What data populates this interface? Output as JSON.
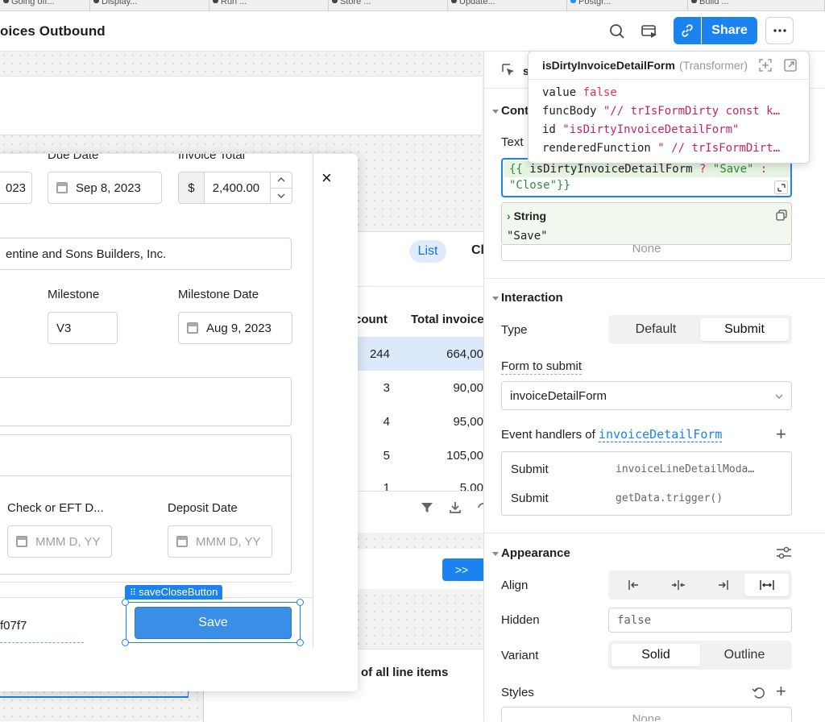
{
  "tabs": [
    "Going off...",
    "Display...",
    "Run ...",
    "Store ...",
    "Update...",
    "Postgr...",
    "Build ..."
  ],
  "header": {
    "title": "oices Outbound",
    "share_label": "Share"
  },
  "background": {
    "list_tab": "List",
    "second_tab": "Cl",
    "table": {
      "headers": [
        "count",
        "Total invoice"
      ],
      "rows": [
        [
          "244",
          "664,00"
        ],
        [
          "3",
          "90,00"
        ],
        [
          "4",
          "95,00"
        ],
        [
          "5",
          "105,00"
        ],
        [
          "1",
          "5,00"
        ]
      ]
    },
    "next_button": ">>",
    "footer_text": "of all line items"
  },
  "modal": {
    "due_date_label": "Due Date",
    "invoice_total_label": "Invoice Total",
    "partial_date": "023",
    "due_date": "Sep 8, 2023",
    "currency_symbol": "$",
    "invoice_total": "2,400.00",
    "company": "entine and Sons Builders, Inc.",
    "milestone_label": "Milestone",
    "milestone_date_label": "Milestone Date",
    "milestone": "V3",
    "milestone_date": "Aug 9, 2023",
    "check_label": "Check or EFT D...",
    "deposit_label": "Deposit Date",
    "date_placeholder": "MMM D, YY",
    "color_value": "f07f7",
    "selection_tag": "saveCloseButton",
    "save_label": "Save",
    "close_symbol": "×"
  },
  "popover": {
    "name": "isDirtyInvoiceDetailForm",
    "type": "(Transformer)",
    "rows": [
      {
        "key": "value",
        "value": "false"
      },
      {
        "key": "funcBody",
        "value": "\"// trIsFormDirty const k…"
      },
      {
        "key": "id",
        "value": "\"isDirtyInvoiceDetailForm\""
      },
      {
        "key": "renderedFunction",
        "value": "\" // trIsFormDirt…"
      }
    ]
  },
  "inspector": {
    "header_partial": "s",
    "content_section": "Cont",
    "text_label": "Text",
    "code_line1_open": "{{ ",
    "code_line1_var": "isDirtyInvoiceDetailForm",
    "code_line1_q": " ? ",
    "code_line1_save": "\"Save\"",
    "code_line1_colon": " :",
    "code_line2_close": "\"Close\"",
    "code_line2_end": "}}",
    "result_type": "String",
    "result_value": "\"Save\"",
    "none_label": "None",
    "interaction_section": "Interaction",
    "type_label": "Type",
    "type_options": [
      "Default",
      "Submit"
    ],
    "form_to_submit_label": "Form to submit",
    "form_to_submit_value": "invoiceDetailForm",
    "event_handlers_prefix": "Event handlers of ",
    "event_handlers_form": "invoiceDetailForm",
    "handlers": [
      {
        "event": "Submit",
        "action": "invoiceLineDetailModa…"
      },
      {
        "event": "Submit",
        "action": "getData.trigger()"
      }
    ],
    "appearance_section": "Appearance",
    "align_label": "Align",
    "hidden_label": "Hidden",
    "hidden_value": "false",
    "variant_label": "Variant",
    "variant_options": [
      "Solid",
      "Outline"
    ],
    "styles_label": "Styles",
    "styles_none": "None"
  },
  "colors": {
    "accent": "#1a83f0",
    "save_button": "#3b8ee6",
    "string_red": "#e0344d"
  }
}
